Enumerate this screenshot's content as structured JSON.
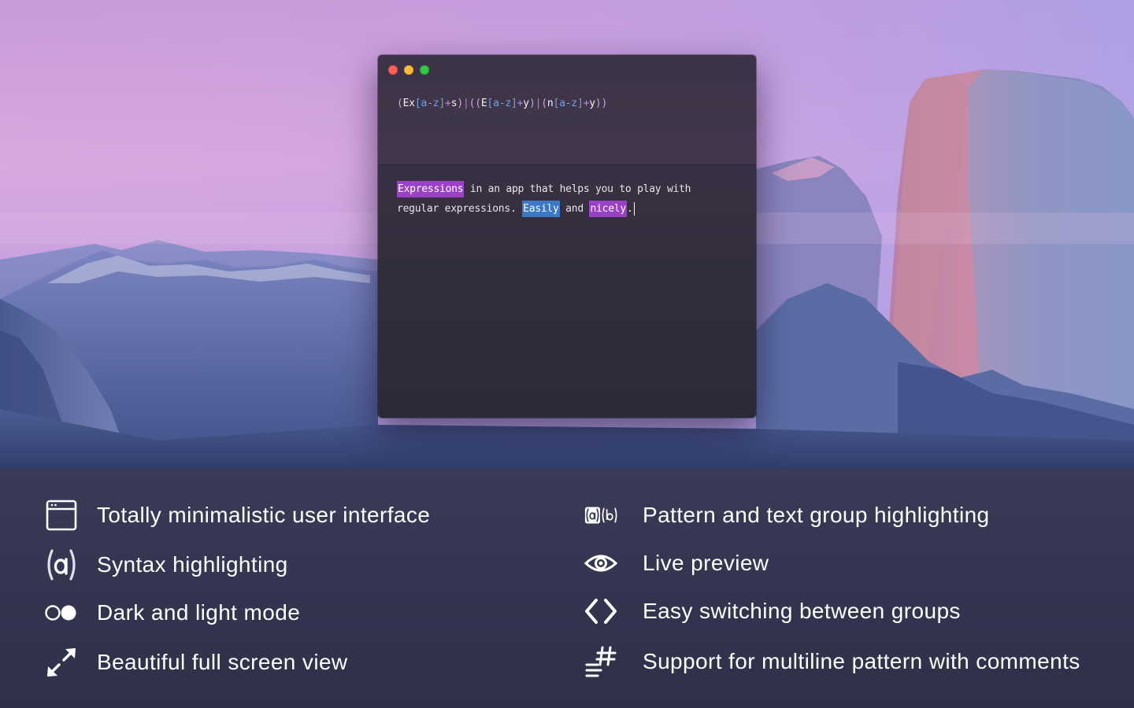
{
  "window": {
    "pattern_tokens": [
      {
        "t": "(",
        "k": "paren"
      },
      {
        "t": "Ex",
        "k": "lit"
      },
      {
        "t": "[a-z]",
        "k": "cls"
      },
      {
        "t": "+",
        "k": "quant"
      },
      {
        "t": "s",
        "k": "lit"
      },
      {
        "t": ")",
        "k": "paren"
      },
      {
        "t": "|",
        "k": "alt"
      },
      {
        "t": "((",
        "k": "paren"
      },
      {
        "t": "E",
        "k": "lit"
      },
      {
        "t": "[a-z]",
        "k": "cls"
      },
      {
        "t": "+",
        "k": "quant"
      },
      {
        "t": "y",
        "k": "lit"
      },
      {
        "t": ")",
        "k": "paren"
      },
      {
        "t": "|",
        "k": "alt"
      },
      {
        "t": "(",
        "k": "paren"
      },
      {
        "t": "n",
        "k": "lit"
      },
      {
        "t": "[a-z]",
        "k": "cls"
      },
      {
        "t": "+",
        "k": "quant"
      },
      {
        "t": "y",
        "k": "lit"
      },
      {
        "t": "))",
        "k": "paren"
      }
    ],
    "sample": {
      "line1_match": "Expressions",
      "line1_rest": " in an app that helps you to play with",
      "line2_start": "regular expressions. ",
      "line2_match1": "Easily",
      "line2_mid": " and ",
      "line2_match2": "nicely",
      "line2_end": "."
    }
  },
  "features": {
    "left": [
      {
        "label": "Totally minimalistic user interface",
        "icon": "window-icon"
      },
      {
        "label": "Syntax highlighting",
        "icon": "syntax-a-icon"
      },
      {
        "label": "Dark and light mode",
        "icon": "toggle-icon"
      },
      {
        "label": "Beautiful full screen view",
        "icon": "fullscreen-arrows-icon"
      }
    ],
    "right": [
      {
        "label": "Pattern and text group highlighting",
        "icon": "group-ab-icon"
      },
      {
        "label": "Live preview",
        "icon": "eye-icon"
      },
      {
        "label": "Easy switching between groups",
        "icon": "angle-brackets-icon"
      },
      {
        "label": "Support for multiline pattern with comments",
        "icon": "hash-lines-icon"
      }
    ]
  },
  "colors": {
    "highlight_purple": "#9b41c8",
    "highlight_blue": "#3a78c8",
    "traffic_close": "#fc605c",
    "traffic_min": "#fdbc40",
    "traffic_max": "#34c84a"
  }
}
